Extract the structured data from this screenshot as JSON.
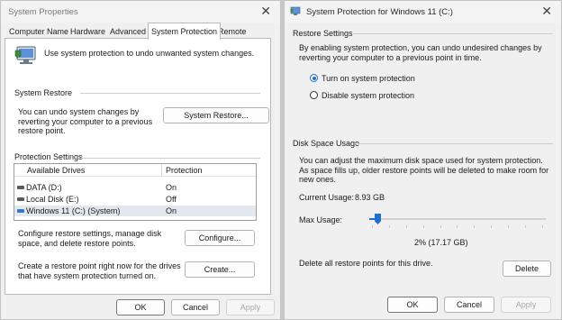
{
  "left": {
    "title": "System Properties",
    "tabs": [
      "Computer Name",
      "Hardware",
      "Advanced",
      "System Protection",
      "Remote"
    ],
    "intro": "Use system protection to undo unwanted system changes.",
    "restore": {
      "heading": "System Restore",
      "desc": "You can undo system changes by reverting your computer to a previous restore point.",
      "button": "System Restore..."
    },
    "protection": {
      "heading": "Protection Settings",
      "col_drives": "Available Drives",
      "col_protection": "Protection",
      "drives": [
        {
          "name": "DATA (D:)",
          "protection": "On"
        },
        {
          "name": "Local Disk (E:)",
          "protection": "Off"
        },
        {
          "name": "Windows 11 (C:) (System)",
          "protection": "On"
        }
      ],
      "configure_desc": "Configure restore settings, manage disk space, and delete restore points.",
      "configure_button": "Configure...",
      "create_desc": "Create a restore point right now for the drives that have system protection turned on.",
      "create_button": "Create..."
    },
    "buttons": {
      "ok": "OK",
      "cancel": "Cancel",
      "apply": "Apply"
    }
  },
  "right": {
    "title": "System Protection for Windows 11 (C:)",
    "restore_settings": {
      "heading": "Restore Settings",
      "desc": "By enabling system protection, you can undo undesired changes by reverting your computer to a previous point in time.",
      "option_on": "Turn on system protection",
      "option_off": "Disable system protection",
      "selected": "on"
    },
    "disk_space": {
      "heading": "Disk Space Usage",
      "desc": "You can adjust the maximum disk space used for system protection. As space fills up, older restore points will be deleted to make room for new ones.",
      "current_label": "Current Usage:",
      "current_value": "8.93 GB",
      "max_label": "Max Usage:",
      "max_percent": 0.02,
      "max_text": "2% (17.17 GB)",
      "delete_desc": "Delete all restore points for this drive.",
      "delete_button": "Delete"
    },
    "buttons": {
      "ok": "OK",
      "cancel": "Cancel",
      "apply": "Apply"
    }
  },
  "icons": [
    "close-icon",
    "system-protection-icon",
    "drive-icon",
    "system-drive-icon"
  ],
  "colors": {
    "accent": "#1f6fd1",
    "selected_row": "#e3e8ef",
    "disabled_text": "#a8a8a8"
  }
}
